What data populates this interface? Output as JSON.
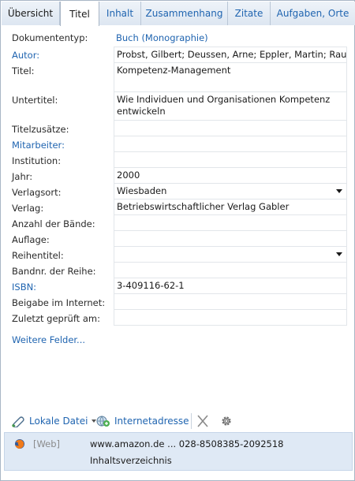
{
  "tabs": [
    {
      "label": "Übersicht"
    },
    {
      "label": "Titel"
    },
    {
      "label": "Inhalt"
    },
    {
      "label": "Zusammenhang"
    },
    {
      "label": "Zitate"
    },
    {
      "label": "Aufgaben, Orte"
    }
  ],
  "active_tab": "Titel",
  "fields": {
    "dokumententyp": {
      "label": "Dokumententyp:",
      "value": "Buch (Monographie)"
    },
    "autor": {
      "label": "Autor:",
      "value": "Probst, Gilbert; Deussen, Arne; Eppler, Martin; Raub, Ste"
    },
    "titel": {
      "label": "Titel:",
      "value": "Kompetenz-Management"
    },
    "untertitel": {
      "label": "Untertitel:",
      "value": "Wie Individuen und Organisationen Kompetenz entwickeln"
    },
    "titelzusaetze": {
      "label": "Titelzusätze:",
      "value": ""
    },
    "mitarbeiter": {
      "label": "Mitarbeiter:",
      "value": ""
    },
    "institution": {
      "label": "Institution:",
      "value": ""
    },
    "jahr": {
      "label": "Jahr:",
      "value": "2000"
    },
    "verlagsort": {
      "label": "Verlagsort:",
      "value": "Wiesbaden"
    },
    "verlag": {
      "label": "Verlag:",
      "value": "Betriebswirtschaftlicher Verlag Gabler"
    },
    "anzahl_baende": {
      "label": "Anzahl der Bände:",
      "value": ""
    },
    "auflage": {
      "label": "Auflage:",
      "value": ""
    },
    "reihentitel": {
      "label": "Reihentitel:",
      "value": ""
    },
    "bandnr": {
      "label": "Bandnr. der Reihe:",
      "value": ""
    },
    "isbn": {
      "label": "ISBN:",
      "value": "3-409116-62-1"
    },
    "beigabe": {
      "label": "Beigabe im Internet:",
      "value": ""
    },
    "zuletzt_geprueft": {
      "label": "Zuletzt geprüft am:",
      "value": ""
    }
  },
  "more_fields_link": "Weitere Felder...",
  "toolbar": {
    "local_file": "Lokale Datei",
    "internet_address": "Internetadresse"
  },
  "attachment": {
    "type": "[Web]",
    "url": "www.amazon.de ... 028-8508385-2092518",
    "description": "Inhaltsverzeichnis"
  },
  "icons": {
    "local_file": "paperclip-icon",
    "internet_address": "globe-link-icon",
    "delete": "close-icon",
    "settings": "gear-icon",
    "attachment": "firefox-web-icon"
  },
  "colors": {
    "link": "#1f64b0",
    "tab_bg": "#e8eef6",
    "selection": "#dfe9f5"
  }
}
